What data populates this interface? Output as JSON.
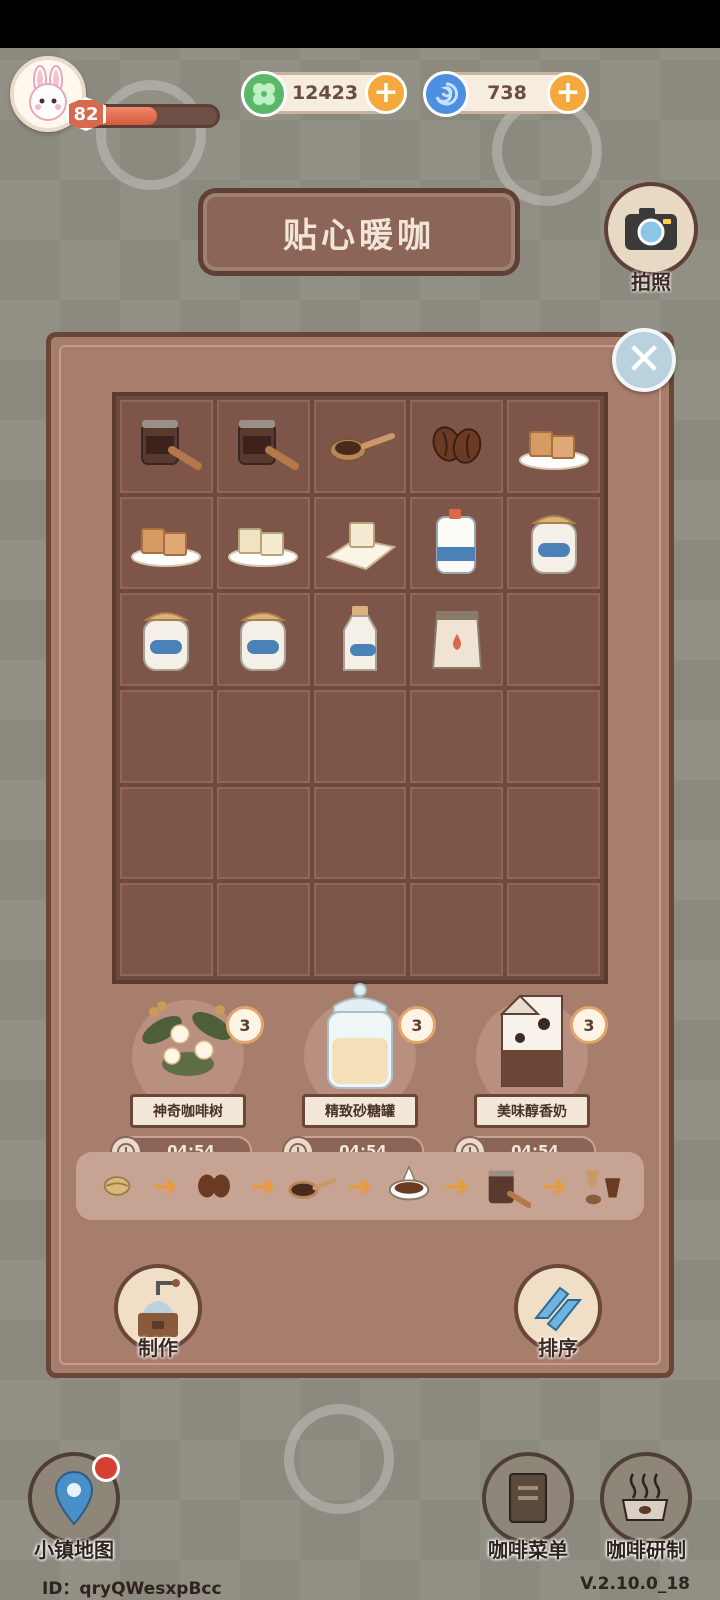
{
  "player": {
    "level": "82",
    "level_progress": 0.55
  },
  "currencies": [
    {
      "name": "clover-coin",
      "value": "12423",
      "color": "#5bb86a"
    },
    {
      "name": "blue-swirl",
      "value": "738",
      "color": "#4d8fe0"
    }
  ],
  "title": "贴心暖咖",
  "camera": {
    "label": "拍照"
  },
  "inventory": {
    "rows": 6,
    "cols": 5,
    "items": [
      "moka-pot",
      "moka-pot",
      "coffee-scoop",
      "coffee-beans",
      "sugar-cubes-brown",
      "sugar-cubes-brown",
      "sugar-cubes-white",
      "sugar-cube-single",
      "milk-jug",
      "milk-jar",
      "milk-jar",
      "milk-jar",
      "milk-bottle",
      "milk-pouch",
      "",
      "",
      "",
      "",
      "",
      "",
      "",
      "",
      "",
      "",
      "",
      "",
      "",
      "",
      "",
      ""
    ]
  },
  "generators": [
    {
      "label": "神奇咖啡树",
      "count": "3",
      "timer": "04:54",
      "icon": "coffee-tree-icon"
    },
    {
      "label": "精致砂糖罐",
      "count": "3",
      "timer": "04:54",
      "icon": "sugar-jar-icon"
    },
    {
      "label": "美味醇香奶",
      "count": "3",
      "timer": "04:54",
      "icon": "milk-carton-icon"
    }
  ],
  "chain": [
    "coffee-bean-raw",
    "coffee-beans-roasted",
    "coffee-scoop",
    "coffee-cup",
    "moka-pot",
    "coffee-capsules"
  ],
  "actions": {
    "craft": "制作",
    "sort": "排序"
  },
  "footer": {
    "map": "小镇地图",
    "menu": "咖啡菜单",
    "research": "咖啡研制",
    "id": "ID：qryQWesxpBcc",
    "version": "V.2.10.0_18"
  }
}
